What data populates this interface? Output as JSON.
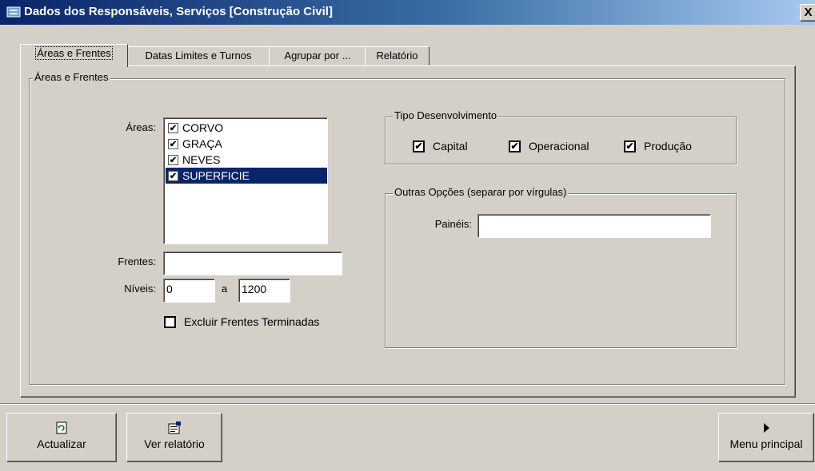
{
  "window": {
    "title": "Dados dos Responsáveis, Serviços [Construção Civil]",
    "close_label": "X"
  },
  "tabs": [
    {
      "label": "Áreas e Frentes"
    },
    {
      "label": "Datas Limites e Turnos"
    },
    {
      "label": "Agrupar por ..."
    },
    {
      "label": "Relatório"
    }
  ],
  "areas_frentes": {
    "group_title": "Áreas e Frentes",
    "areas_label": "Áreas:",
    "areas": [
      {
        "label": "CORVO",
        "checked": true
      },
      {
        "label": "GRAÇA",
        "checked": true
      },
      {
        "label": "NEVES",
        "checked": true
      },
      {
        "label": "SUPERFICIE",
        "checked": true,
        "selected": true
      }
    ],
    "frentes_label": "Frentes:",
    "frentes_value": "",
    "niveis_label": "Níveis:",
    "niveis_from": "0",
    "niveis_sep": "a",
    "niveis_to": "1200",
    "excluir_label": "Excluir Frentes Terminadas",
    "excluir_checked": false
  },
  "tipo_desenvolvimento": {
    "group_title": "Tipo Desenvolvimento",
    "options": [
      {
        "label": "Capital",
        "checked": true
      },
      {
        "label": "Operacional",
        "checked": true
      },
      {
        "label": "Produção",
        "checked": true
      }
    ]
  },
  "outras_opcoes": {
    "group_title": "Outras Opções (separar por vírgulas)",
    "paineis_label": "Painéis:",
    "paineis_value": ""
  },
  "buttons": {
    "actualizar": "Actualizar",
    "ver_relatorio": "Ver relatório",
    "menu_principal": "Menu principal"
  },
  "colors": {
    "titlebar_start": "#0a246a",
    "selection": "#0a246a",
    "face": "#d4d0c8"
  }
}
